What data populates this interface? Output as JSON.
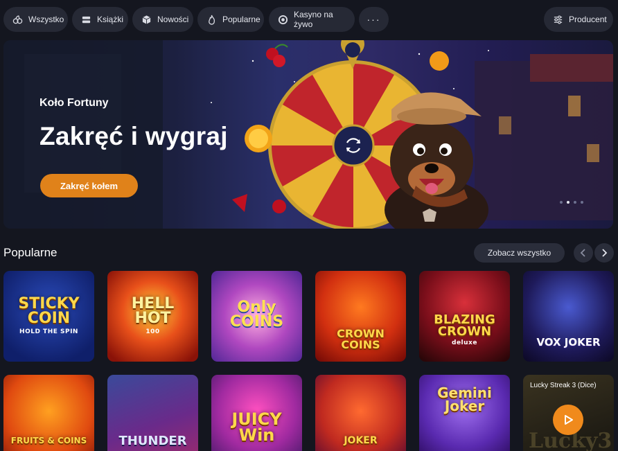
{
  "filters": [
    {
      "label": "Wszystko",
      "icon": "fruit-icon"
    },
    {
      "label": "Książki",
      "icon": "books-icon"
    },
    {
      "label": "Nowości",
      "icon": "box-icon"
    },
    {
      "label": "Popularne",
      "icon": "fire-icon"
    },
    {
      "label": "Kasyno na żywo",
      "icon": "chip-icon"
    },
    {
      "label": "···",
      "icon": "more-icon"
    }
  ],
  "producer": {
    "label": "Producent",
    "icon": "sliders-icon"
  },
  "hero": {
    "subtitle": "Koło Fortuny",
    "title": "Zakręć i wygraj",
    "button": "Zakręć kołem",
    "slides": 4,
    "active_slide": 2
  },
  "popular": {
    "title": "Popularne",
    "see_all": "Zobacz wszystko",
    "games_row1": [
      {
        "name": "STICKY COIN",
        "sub": "HOLD THE SPIN"
      },
      {
        "name": "HELL HOT",
        "sub": "100"
      },
      {
        "name": "Only COINS",
        "sub": ""
      },
      {
        "name": "CROWN COINS",
        "sub": ""
      },
      {
        "name": "BLAZING CROWN",
        "sub": "deluxe"
      },
      {
        "name": "VOX JOKER",
        "sub": ""
      }
    ],
    "games_row2": [
      {
        "name": "FRUITS & COINS",
        "sub": ""
      },
      {
        "name": "THUNDER",
        "sub": ""
      },
      {
        "name": "JUICY Win",
        "sub": ""
      },
      {
        "name": "JOKER",
        "sub": ""
      },
      {
        "name": "Gemini Joker",
        "sub": ""
      }
    ],
    "live_game": {
      "label": "Lucky Streak 3 (Dice)",
      "art_text": "Lucky3"
    }
  },
  "colors": {
    "accent": "#e0821a",
    "background": "#14161f",
    "chip": "#262935"
  }
}
